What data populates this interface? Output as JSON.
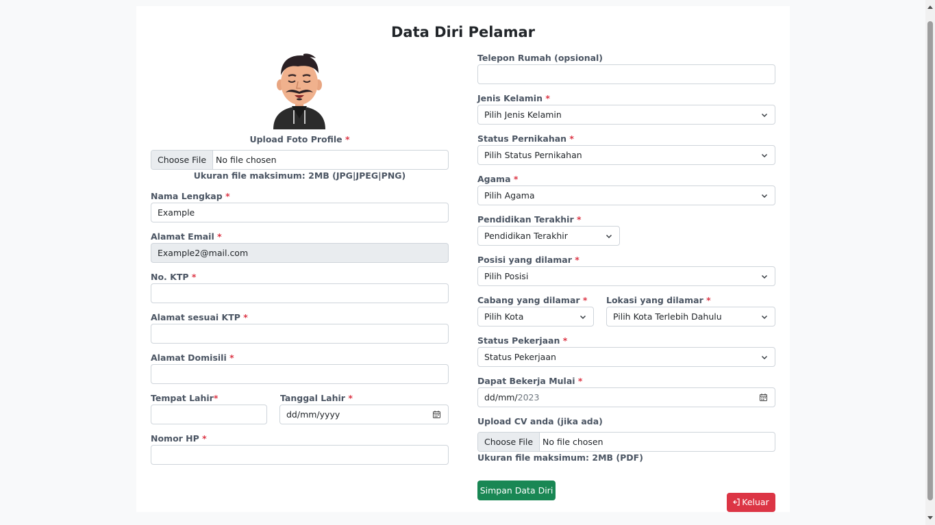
{
  "page": {
    "title": "Data Diri Pelamar"
  },
  "photo": {
    "label": "Upload Foto Profile",
    "required_mark": "*",
    "file_button": "Choose File",
    "file_status": "No file chosen",
    "hint": "Ukuran file maksimum: 2MB (JPG|JPEG|PNG)"
  },
  "left": {
    "nama": {
      "label": "Nama Lengkap",
      "value": "Example"
    },
    "email": {
      "label": "Alamat Email",
      "value": "Example2@mail.com"
    },
    "ktp": {
      "label": "No. KTP",
      "value": ""
    },
    "alamat_ktp": {
      "label": "Alamat sesuai KTP",
      "value": ""
    },
    "domisili": {
      "label": "Alamat Domisili",
      "value": ""
    },
    "tempat_lahir": {
      "label": "Tempat Lahir",
      "value": ""
    },
    "tanggal_lahir": {
      "label": "Tanggal Lahir",
      "placeholder": "dd/mm/yyyy"
    },
    "nomor_hp": {
      "label": "Nomor HP",
      "value": ""
    }
  },
  "right": {
    "telepon": {
      "label": "Telepon Rumah (opsional)",
      "value": ""
    },
    "jenis_kelamin": {
      "label": "Jenis Kelamin",
      "selected": "Pilih Jenis Kelamin"
    },
    "status_pernikahan": {
      "label": "Status Pernikahan",
      "selected": "Pilih Status Pernikahan"
    },
    "agama": {
      "label": "Agama",
      "selected": "Pilih Agama"
    },
    "pendidikan": {
      "label": "Pendidikan Terakhir",
      "selected": "Pendidikan Terakhir"
    },
    "posisi": {
      "label": "Posisi yang dilamar",
      "selected": "Pilih Posisi"
    },
    "cabang": {
      "label": "Cabang yang dilamar",
      "selected": "Pilih Kota"
    },
    "lokasi": {
      "label": "Lokasi yang dilamar",
      "selected": "Pilih Kota Terlebih Dahulu"
    },
    "status_pekerjaan": {
      "label": "Status Pekerjaan",
      "selected": "Status Pekerjaan"
    },
    "mulai": {
      "label": "Dapat Bekerja Mulai",
      "date_prefix": "dd/mm/",
      "date_year": "2023"
    },
    "cv": {
      "label": "Upload CV anda (jika ada)",
      "file_button": "Choose File",
      "file_status": "No file chosen",
      "hint": "Ukuran file maksimum: 2MB (PDF)"
    }
  },
  "buttons": {
    "save": "Simpan Data Diri",
    "logout": "Keluar"
  },
  "required_mark": "*",
  "colors": {
    "accent_green": "#198754",
    "accent_red": "#dc3545",
    "required": "#dc3545"
  },
  "icons": [
    "avatar",
    "chevron-down-icon",
    "calendar-icon",
    "logout-icon"
  ]
}
